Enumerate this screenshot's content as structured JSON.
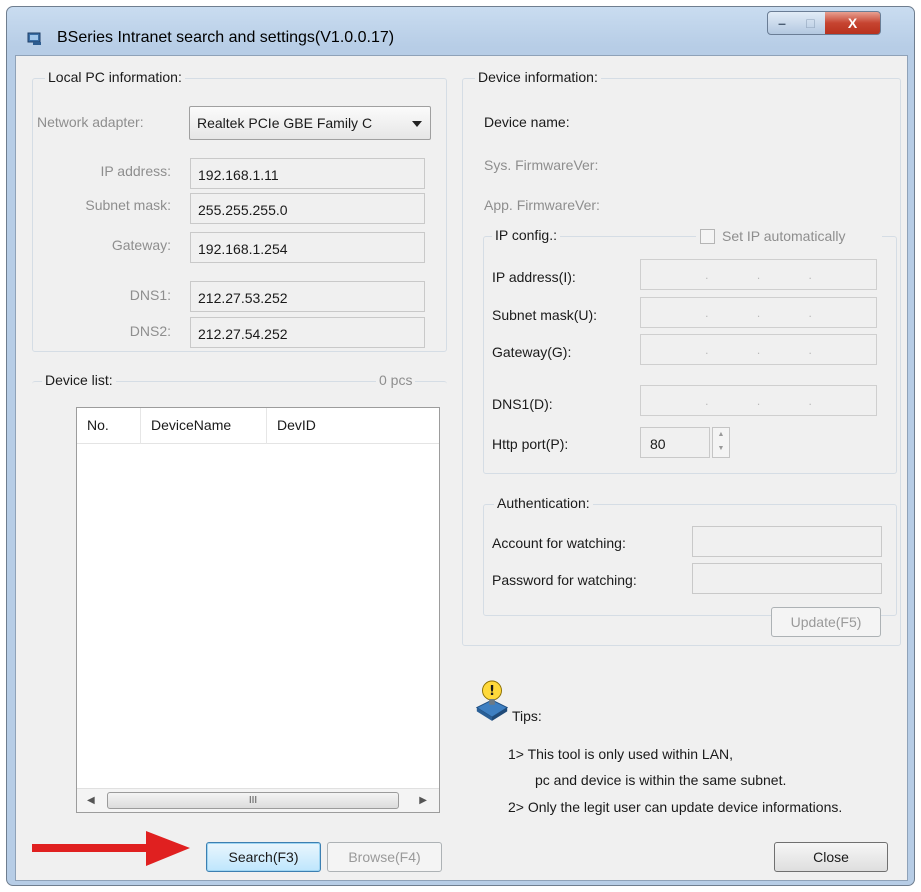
{
  "window": {
    "title": "BSeries Intranet search and settings(V1.0.0.17)",
    "controls": {
      "minimize": "–",
      "maximize": "□",
      "close": "X"
    }
  },
  "local_pc": {
    "group_title": "Local PC information:",
    "network_adapter_label": "Network adapter:",
    "network_adapter_value": "Realtek PCIe GBE Family C",
    "ip_label": "IP address:",
    "ip_value": "192.168.1.11",
    "subnet_label": "Subnet mask:",
    "subnet_value": "255.255.255.0",
    "gateway_label": "Gateway:",
    "gateway_value": "192.168.1.254",
    "dns1_label": "DNS1:",
    "dns1_value": "212.27.53.252",
    "dns2_label": "DNS2:",
    "dns2_value": "212.27.54.252"
  },
  "device_list": {
    "group_title": "Device list:",
    "count": "0 pcs",
    "columns": [
      "No.",
      "DeviceName",
      "DevID"
    ],
    "rows": [],
    "scroll_thumb": "III"
  },
  "device_info": {
    "group_title": "Device information:",
    "device_name_label": "Device name:",
    "sys_fw_label": "Sys. FirmwareVer:",
    "app_fw_label": "App. FirmwareVer:",
    "ip_config": {
      "group_title": "IP config.:",
      "auto_label": "Set IP automatically",
      "auto_checked": false,
      "ip_label": "IP address(I):",
      "subnet_label": "Subnet mask(U):",
      "gateway_label": "Gateway(G):",
      "dns1_label": "DNS1(D):",
      "http_port_label": "Http port(P):",
      "http_port_value": "80"
    },
    "auth": {
      "group_title": "Authentication:",
      "account_label": "Account for watching:",
      "password_label": "Password for watching:"
    },
    "update_label": "Update(F5)"
  },
  "tips": {
    "title": "Tips:",
    "line1": "1> This tool is only used within LAN,",
    "line2": "pc and device is within the same subnet.",
    "line3": "2> Only the legit user can update  device informations."
  },
  "buttons": {
    "search": "Search(F3)",
    "browse": "Browse(F4)",
    "close": "Close"
  },
  "colors": {
    "annotation_arrow": "#e02020",
    "window_frame": "#b7cde6",
    "client_bg": "#f0f0f0"
  }
}
